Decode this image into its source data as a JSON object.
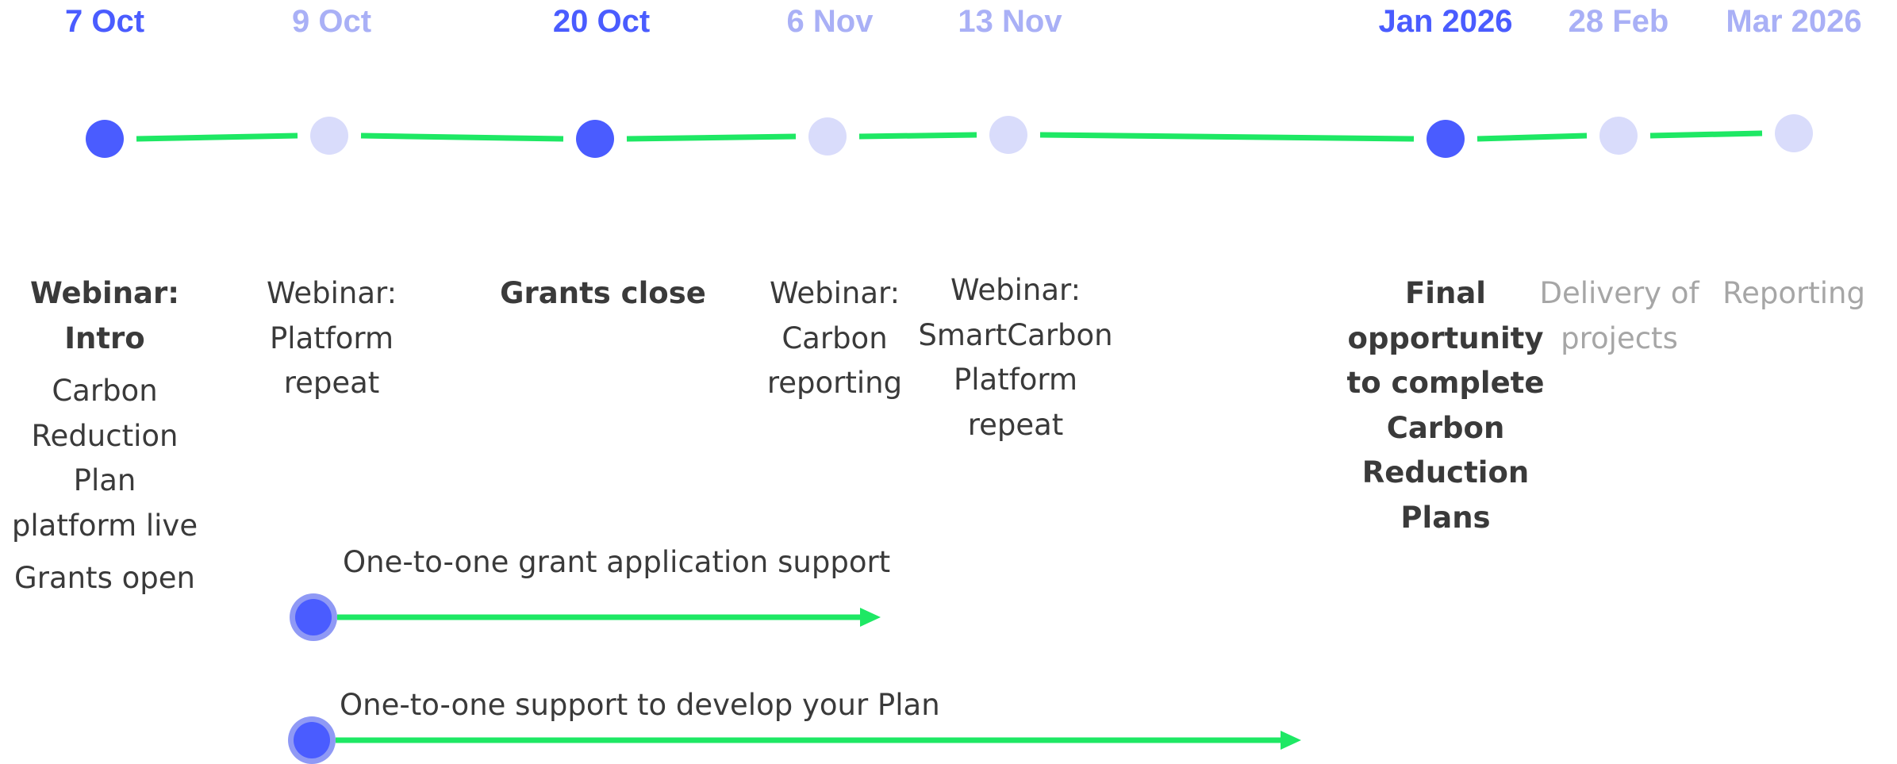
{
  "colors": {
    "accent": "#4a5cff",
    "accent_faint": "#d9dcfb",
    "date_faint": "#a9b0f6",
    "connector": "#1ee864",
    "text": "#3a3a3a",
    "text_muted": "#a6a6a6",
    "ring": "#8f99f5"
  },
  "milestones": [
    {
      "date": "7 Oct",
      "emphasis": "strong",
      "label": [
        [
          "Webinar:",
          "Intro"
        ],
        [
          "Carbon",
          "Reduction",
          "Plan",
          "platform live"
        ],
        [
          "Grants open"
        ]
      ]
    },
    {
      "date": "9 Oct",
      "emphasis": "faint",
      "label": [
        [
          "Webinar:",
          "Platform",
          "repeat"
        ]
      ]
    },
    {
      "date": "20 Oct",
      "emphasis": "strong",
      "label": [
        [
          "Grants close"
        ]
      ]
    },
    {
      "date": "6 Nov",
      "emphasis": "faint",
      "label": [
        [
          "Webinar:",
          "Carbon",
          "reporting"
        ]
      ]
    },
    {
      "date": "13 Nov",
      "emphasis": "faint",
      "label": [
        [
          "Webinar:",
          "SmartCarbon",
          "Platform",
          "repeat"
        ]
      ]
    },
    {
      "date": "Jan 2026",
      "emphasis": "strong",
      "label": [
        [
          "Final",
          "opportunity",
          "to complete",
          "Carbon",
          "Reduction",
          "Plans"
        ]
      ]
    },
    {
      "date": "28 Feb",
      "emphasis": "faint",
      "label": [
        [
          "Delivery of",
          "projects"
        ]
      ]
    },
    {
      "date": "Mar 2026",
      "emphasis": "faint",
      "label": [
        [
          "Reporting"
        ]
      ]
    }
  ],
  "support_tracks": [
    {
      "label": "One-to-one grant application support"
    },
    {
      "label": "One-to-one support to develop your Plan"
    }
  ]
}
